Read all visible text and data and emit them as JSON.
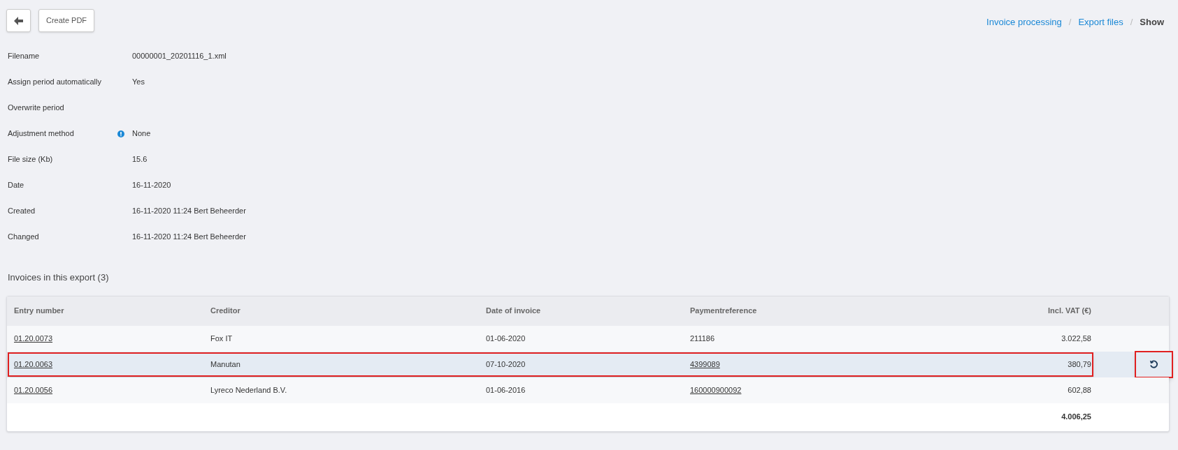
{
  "toolbar": {
    "create_pdf": "Create PDF"
  },
  "breadcrumb": [
    {
      "label": "Invoice processing",
      "current": false
    },
    {
      "label": "Export files",
      "current": false
    },
    {
      "label": "Show",
      "current": true
    }
  ],
  "breadcrumb_separator": "/",
  "details": [
    {
      "label": "Filename",
      "value": "00000001_20201116_1.xml",
      "info": false
    },
    {
      "label": "Assign period automatically",
      "value": "Yes",
      "info": false
    },
    {
      "label": "Overwrite period",
      "info": false
    },
    {
      "label": "Adjustment method",
      "value": "None",
      "info": true
    },
    {
      "label": "File size (Kb)",
      "value": "15.6",
      "info": false
    },
    {
      "label": "Date",
      "value": "16-11-2020",
      "info": false
    },
    {
      "label": "Created",
      "value": "16-11-2020 11:24 Bert Beheerder",
      "info": false
    },
    {
      "label": "Changed",
      "value": "16-11-2020 11:24 Bert Beheerder",
      "info": false
    }
  ],
  "section_title": "Invoices in this export (3)",
  "table": {
    "columns": [
      "Entry number",
      "Creditor",
      "Date of invoice",
      "Paymentreference",
      "Incl. VAT (€)"
    ],
    "rows": [
      {
        "entry": "01.20.0073",
        "creditor": "Fox IT",
        "date": "01-06-2020",
        "reference": "211186",
        "reference_link": false,
        "amount": "3.022,58",
        "highlighted": false
      },
      {
        "entry": "01.20.0063",
        "creditor": "Manutan",
        "date": "07-10-2020",
        "reference": "4399089",
        "reference_link": true,
        "amount": "380,79",
        "highlighted": true
      },
      {
        "entry": "01.20.0056",
        "creditor": "Lyreco Nederland B.V.",
        "date": "01-06-2016",
        "reference": "160000900092",
        "reference_link": true,
        "amount": "602,88",
        "highlighted": false
      }
    ],
    "total": "4.006,25"
  }
}
